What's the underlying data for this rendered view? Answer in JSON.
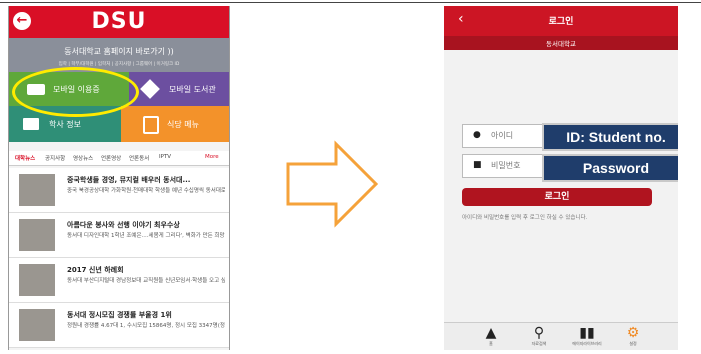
{
  "left_app": {
    "back_icon": "back-arrow-icon",
    "logo": "DSU",
    "home_link": "동서대학교 홈페이지 바로가기 ))",
    "sublinks": "입학 | 학부/대학원 | 입학처 | 공지사항 | 그룹웨어 | 이거링크 ID",
    "tiles": {
      "mobile_id": "모바일 이용증",
      "mobile_library": "모바일 도서관",
      "academic_info": "학사 정보",
      "cafeteria_menu": "식당 메뉴"
    },
    "news_tabs": [
      "대학뉴스",
      "공지사항",
      "영상뉴스",
      "언론영상",
      "언론동서",
      "IPTV",
      "More"
    ],
    "news": [
      {
        "title": "중국학생들 경영, 뮤지컬 배우러 동서대...",
        "desc": "중국 북경공상대학 가화학원·천매대학 학생들 예년 수십명씩 동서대로 경영학·뮤지컬 배우"
      },
      {
        "title": "아름다운 봉사와 선행 이야기 최우수상",
        "desc": "동서대 디자인대학 1학년 조예은....세봄게 그리다', 벽화가 만든 희망"
      },
      {
        "title": "2017 신년 하례회",
        "desc": "동서대 부산디지털대 경남정보대 교직원들 신년모임서·학생들 오고 싶어 하는 대학 만드는"
      },
      {
        "title": "동서대 정시모집 경쟁률 부울경 1위",
        "desc": "정원내 경쟁률 4.67대 1, 수시모집 15864명, 정시 모집 3347명(정원내외 포함)"
      }
    ]
  },
  "right_app": {
    "back_icon": "chevron-left-icon",
    "title": "로그인",
    "subtitle": "동서대학교",
    "id_placeholder": "아이디",
    "pw_placeholder": "비밀번호",
    "id_overlay": "ID: Student no.",
    "pw_overlay": "Password",
    "login_button": "로그인",
    "hint": "아이디와 비밀번호를 입력 후 로그인 하실 수 있습니다.",
    "footer": [
      {
        "icon": "bank-icon",
        "label": "홈"
      },
      {
        "icon": "search-icon",
        "label": "자료검색"
      },
      {
        "icon": "books-icon",
        "label": "에이지라이브러리"
      },
      {
        "icon": "gear-icon",
        "label": "설정"
      }
    ]
  },
  "colors": {
    "brand_red": "#d90f26",
    "overlay_blue": "#1f3d6b",
    "highlight_yellow": "#ffeb00",
    "arrow_orange": "#f5a23a"
  }
}
